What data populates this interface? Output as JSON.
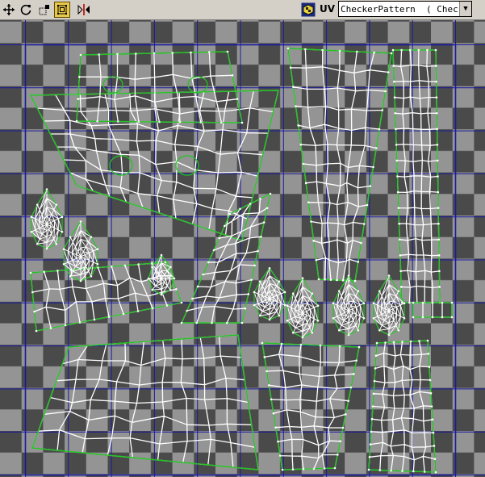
{
  "toolbar": {
    "tools": [
      {
        "name": "move-tool-icon"
      },
      {
        "name": "rotate-tool-icon"
      },
      {
        "name": "scale-tool-icon"
      },
      {
        "name": "freeform-tool-icon",
        "active": true
      },
      {
        "name": "mirror-tool-icon"
      }
    ],
    "uv_label": "UV",
    "texture_select": "CheckerPattern  ( Checker"
  },
  "colors": {
    "checker_light": "#949494",
    "checker_dark": "#4a4a4a",
    "grid_line": "#1a1aa0",
    "uv_seam": "#22c322",
    "uv_edge": "#ffffff"
  }
}
